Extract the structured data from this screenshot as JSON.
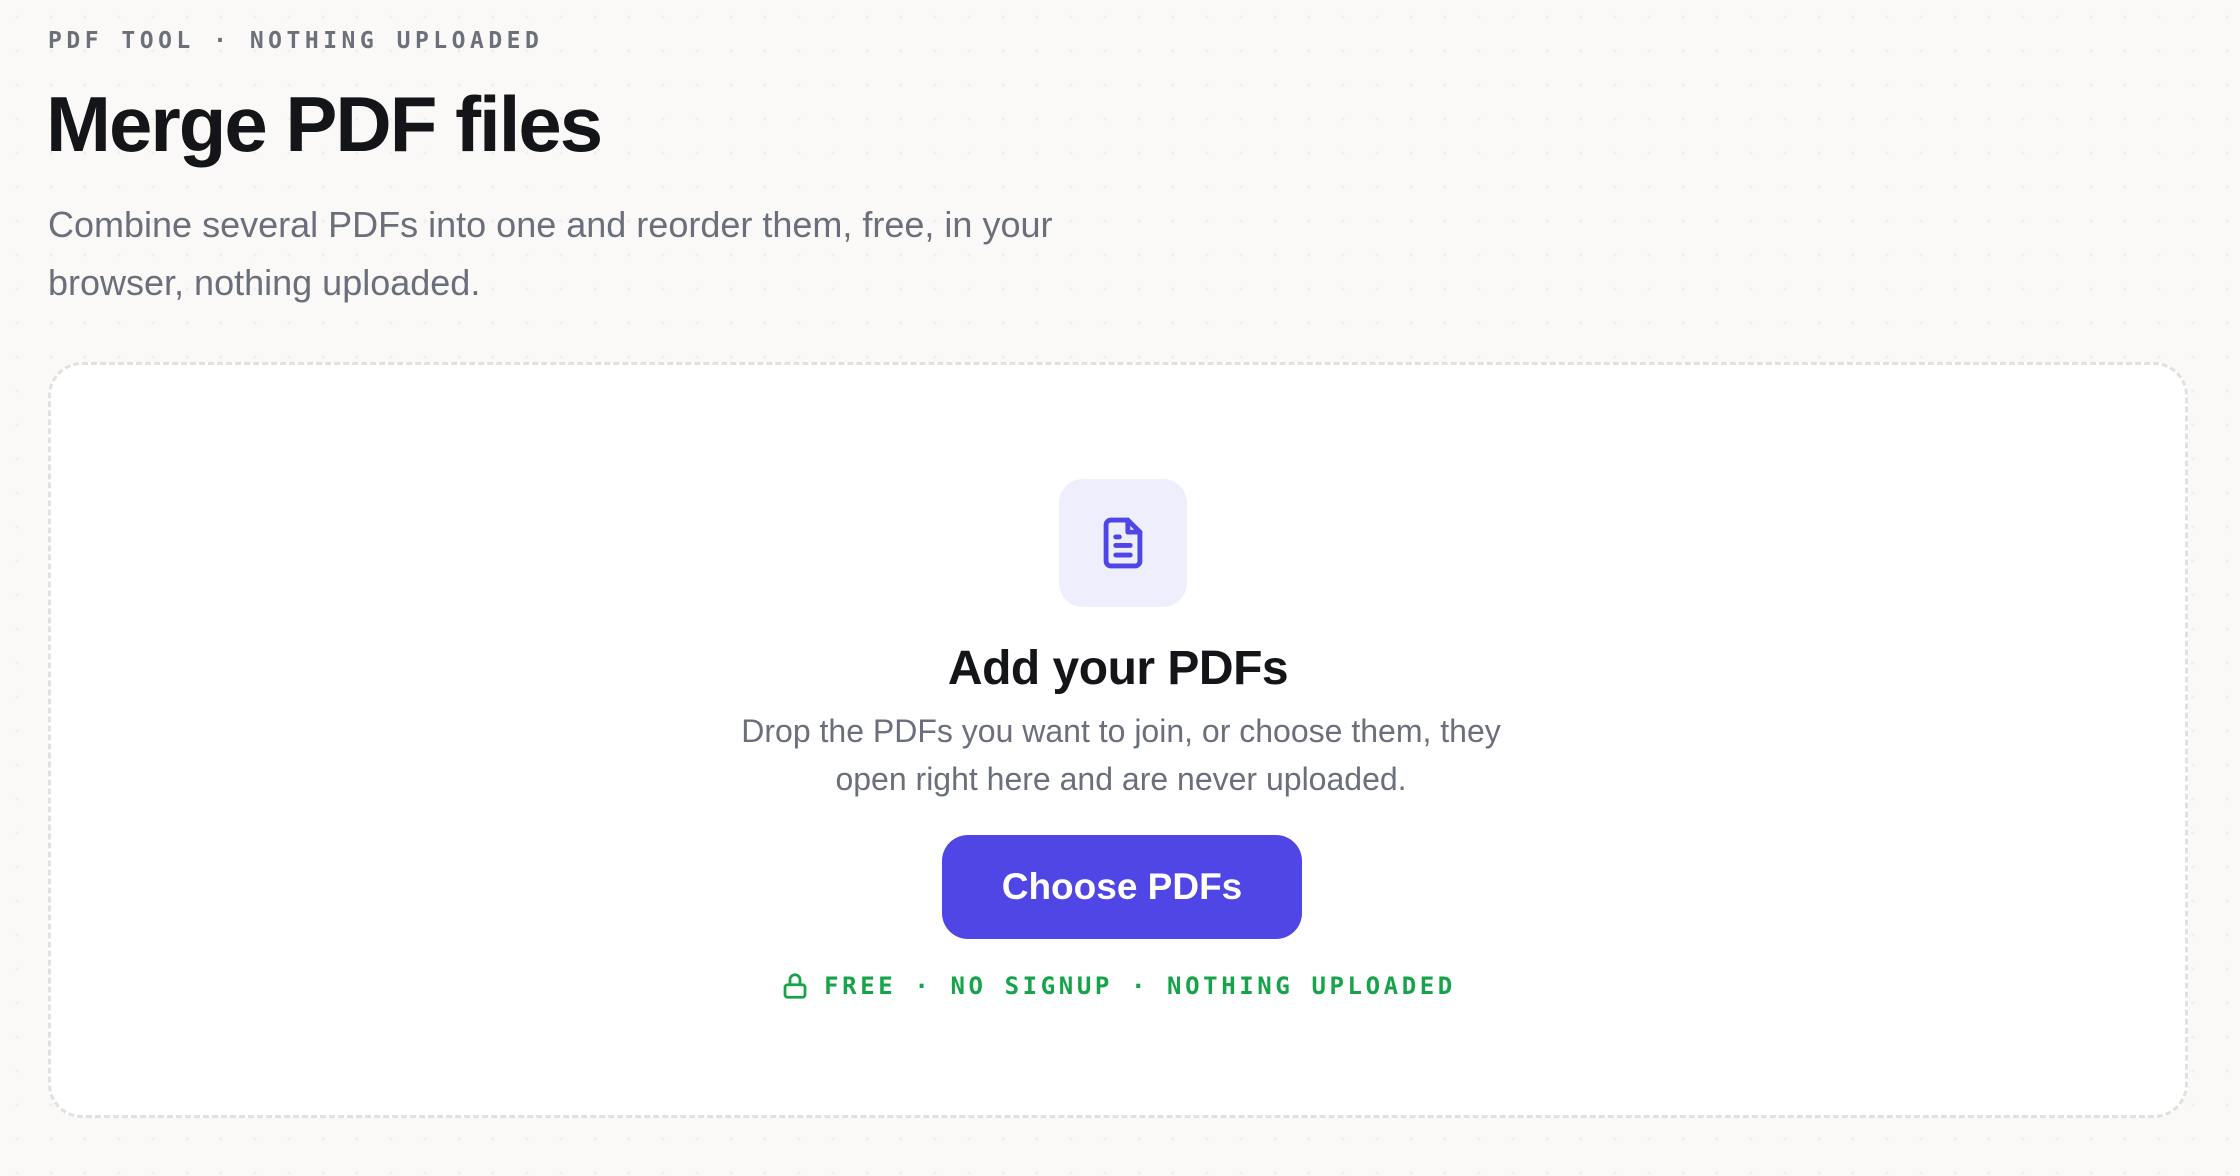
{
  "header": {
    "eyebrow": "PDF TOOL · NOTHING UPLOADED",
    "title": "Merge PDF files",
    "subtitle": "Combine several PDFs into one and reorder them, free, in your browser, nothing uploaded."
  },
  "dropzone": {
    "icon": "document-icon",
    "title": "Add your PDFs",
    "description": "Drop the PDFs you want to join, or choose them, they open right here and are never uploaded.",
    "button_label": "Choose PDFs",
    "trust_icon": "lock-icon",
    "trust_text": "FREE · NO SIGNUP · NOTHING UPLOADED"
  },
  "colors": {
    "accent": "#4f46e5",
    "icon_tile": "#eeeefd",
    "trust": "#16a34a",
    "background": "#faf9f7"
  }
}
